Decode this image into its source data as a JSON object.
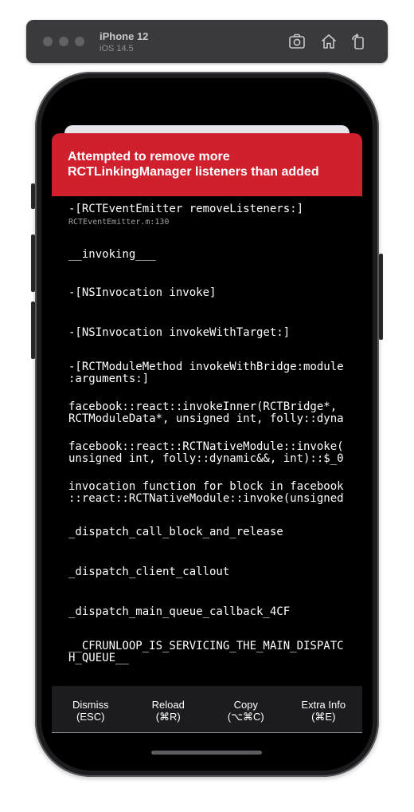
{
  "simulator": {
    "device": "iPhone 12",
    "os": "iOS 14.5",
    "icons": [
      "screenshot-icon",
      "home-icon",
      "rotate-icon"
    ]
  },
  "redbox": {
    "title": "Attempted to remove more RCTLinkingManager listeners than added",
    "accent_color": "#d0202e",
    "frames": [
      {
        "name": "-[RCTEventEmitter removeListeners:]",
        "file": "RCTEventEmitter.m:130"
      },
      {
        "name": "__invoking___",
        "file": ""
      },
      {
        "name": "-[NSInvocation invoke]",
        "file": ""
      },
      {
        "name": "-[NSInvocation invokeWithTarget:]",
        "file": ""
      },
      {
        "name": "-[RCTModuleMethod invokeWithBridge:module\n:arguments:]",
        "file": ""
      },
      {
        "name": "facebook::react::invokeInner(RCTBridge*,\nRCTModuleData*, unsigned int, folly::dyna",
        "file": ""
      },
      {
        "name": "facebook::react::RCTNativeModule::invoke(\nunsigned int, folly::dynamic&&, int)::$_0",
        "file": ""
      },
      {
        "name": "invocation function for block in facebook\n::react::RCTNativeModule::invoke(unsigned",
        "file": ""
      },
      {
        "name": "_dispatch_call_block_and_release",
        "file": ""
      },
      {
        "name": "_dispatch_client_callout",
        "file": ""
      },
      {
        "name": "_dispatch_main_queue_callback_4CF",
        "file": ""
      },
      {
        "name": "__CFRUNLOOP_IS_SERVICING_THE_MAIN_DISPATC\nH_QUEUE__",
        "file": ""
      }
    ],
    "buttons": [
      {
        "label": "Dismiss",
        "shortcut": "(ESC)"
      },
      {
        "label": "Reload",
        "shortcut": "(⌘R)"
      },
      {
        "label": "Copy",
        "shortcut": "(⌥⌘C)"
      },
      {
        "label": "Extra Info",
        "shortcut": "(⌘E)"
      }
    ]
  }
}
